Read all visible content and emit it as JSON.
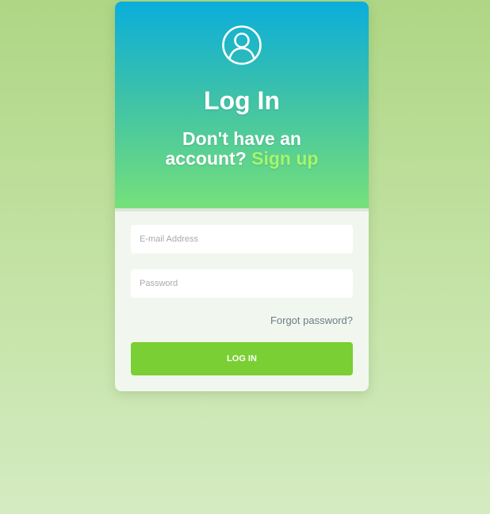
{
  "login": {
    "title": "Log In",
    "subtitle_prefix_line1": "Don't have an",
    "subtitle_prefix_line2": "account?",
    "signup_link": "Sign up",
    "email_placeholder": "E-mail Address",
    "password_placeholder": "Password",
    "forgot_password": "Forgot password?",
    "submit_label": "LOG IN"
  },
  "icons": {
    "header_icon": "user-circle-icon"
  },
  "colors": {
    "header_gradient_top": "#0aaedb",
    "header_gradient_bottom": "#76e07a",
    "signup_link": "#a6f56e",
    "button": "#79cf33",
    "card_body": "#f1f7ee",
    "page_background": "#b9dc96"
  }
}
